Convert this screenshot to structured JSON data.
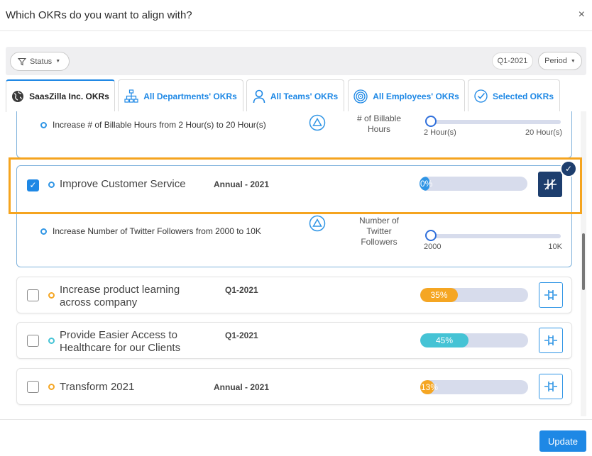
{
  "dialog": {
    "title": "Which OKRs do you want to align with?",
    "close_glyph": "×"
  },
  "filters": {
    "status_label": "Status",
    "quarter_label": "Q1-2021",
    "period_label": "Period"
  },
  "tabs": [
    {
      "label": "SaasZilla Inc. OKRs",
      "icon": "globe-icon",
      "active": true
    },
    {
      "label": "All Departments' OKRs",
      "icon": "org-chart-icon",
      "active": false
    },
    {
      "label": "All Teams' OKRs",
      "icon": "person-icon",
      "active": false
    },
    {
      "label": "All Employees' OKRs",
      "icon": "target-icon",
      "active": false
    },
    {
      "label": "Selected OKRs",
      "icon": "check-circle-icon",
      "active": false
    }
  ],
  "key_results": [
    {
      "text": "Increase # of Billable Hours from 2 Hour(s) to 20 Hour(s)",
      "metric": [
        "# of Billable",
        "Hours"
      ],
      "min_label": "2 Hour(s)",
      "max_label": "20 Hour(s)",
      "progress": 0
    },
    {
      "text": "Increase Number of Twitter Followers from 2000 to 10K",
      "metric": [
        "Number of",
        "Twitter",
        "Followers"
      ],
      "min_label": "2000",
      "max_label": "10K",
      "progress": 0
    }
  ],
  "okrs": [
    {
      "title": "Improve Customer Service",
      "period": "Annual - 2021",
      "progress_label": "0%",
      "progress": 0.04,
      "color": "#2f95e5",
      "checked": true,
      "selected": true
    },
    {
      "title": "Increase product learning across company",
      "period": "Q1-2021",
      "progress_label": "35%",
      "progress": 0.35,
      "color": "#f5a623",
      "checked": false,
      "selected": false
    },
    {
      "title": "Provide Easier Access to Healthcare for our Clients",
      "period": "Q1-2021",
      "progress_label": "45%",
      "progress": 0.45,
      "color": "#45c3d5",
      "checked": false,
      "selected": false
    },
    {
      "title": "Transform 2021",
      "period": "Annual - 2021",
      "progress_label": "13%",
      "progress": 0.13,
      "color": "#f5a623",
      "checked": false,
      "selected": false
    }
  ],
  "footer": {
    "update_label": "Update"
  },
  "colors": {
    "accent": "#1e88e5",
    "highlight": "#f5a41f",
    "selected_dark": "#1d3e6e"
  }
}
